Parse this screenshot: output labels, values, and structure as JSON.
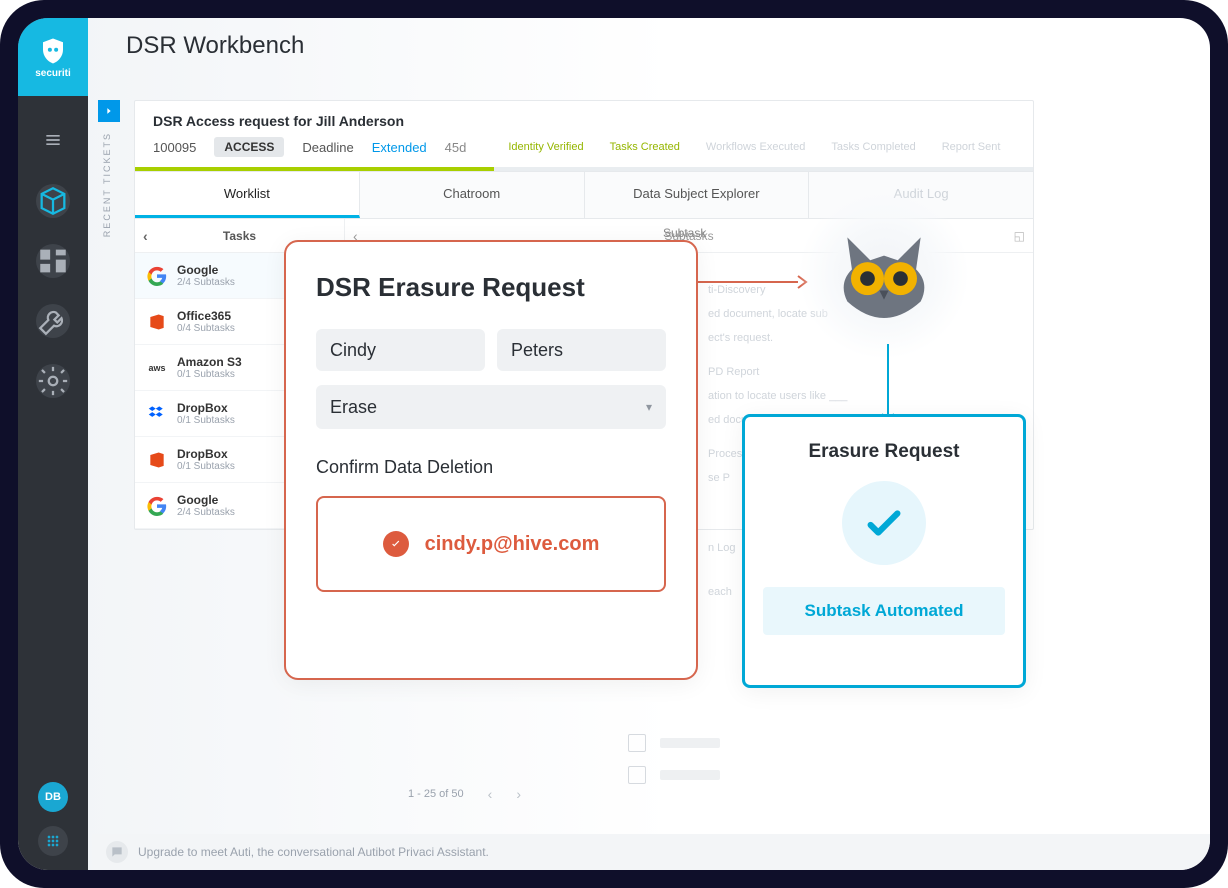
{
  "brand": {
    "name": "securiti"
  },
  "page": {
    "title": "DSR Workbench"
  },
  "recent": {
    "label": "RECENT TICKETS"
  },
  "request": {
    "title": "DSR Access request for Jill Anderson",
    "id": "100095",
    "type": "ACCESS",
    "deadline_label": "Deadline",
    "deadline_status": "Extended",
    "deadline_days": "45d",
    "steps": {
      "s1": "Identity Verified",
      "s2": "Tasks Created",
      "s3": "Workflows Executed",
      "s4": "Tasks Completed",
      "s5": "Report Sent"
    }
  },
  "tabs": {
    "t1": "Worklist",
    "t2": "Chatroom",
    "t3": "Data Subject Explorer",
    "t4": "Audit Log"
  },
  "cols": {
    "tasks": "Tasks",
    "subtasks": "Subtasks",
    "subtask": "Subtask"
  },
  "tasks": [
    {
      "name": "Google",
      "sub": "2/4 Subtasks",
      "icon": "google"
    },
    {
      "name": "Office365",
      "sub": "0/4 Subtasks",
      "icon": "office"
    },
    {
      "name": "Amazon S3",
      "sub": "0/1 Subtasks",
      "icon": "aws"
    },
    {
      "name": "DropBox",
      "sub": "0/1 Subtasks",
      "icon": "dropbox"
    },
    {
      "name": "DropBox",
      "sub": "0/1 Subtasks",
      "icon": "office"
    },
    {
      "name": "Google",
      "sub": "2/4 Subtasks",
      "icon": "google"
    }
  ],
  "ghost": {
    "l0": "ti-Discovery",
    "l1": "ed document, locate sub",
    "l2": "ect's request.",
    "l3": "PD Report",
    "l4": "ation to locate users like ___",
    "l5": "ed documentation.",
    "l6": "Process Record and Resource",
    "l7": "se P",
    "l8": "n Log",
    "l9": "each"
  },
  "pager": {
    "text": "1 - 25 of 50"
  },
  "upgrade": {
    "text": "Upgrade to meet Auti, the conversational Autibot Privaci Assistant."
  },
  "erase": {
    "title": "DSR Erasure Request",
    "first": "Cindy",
    "last": "Peters",
    "action": "Erase",
    "confirm_label": "Confirm Data Deletion",
    "email": "cindy.p@hive.com"
  },
  "result": {
    "title": "Erasure Request",
    "button": "Subtask Automated"
  },
  "avatar": {
    "initials": "DB"
  }
}
